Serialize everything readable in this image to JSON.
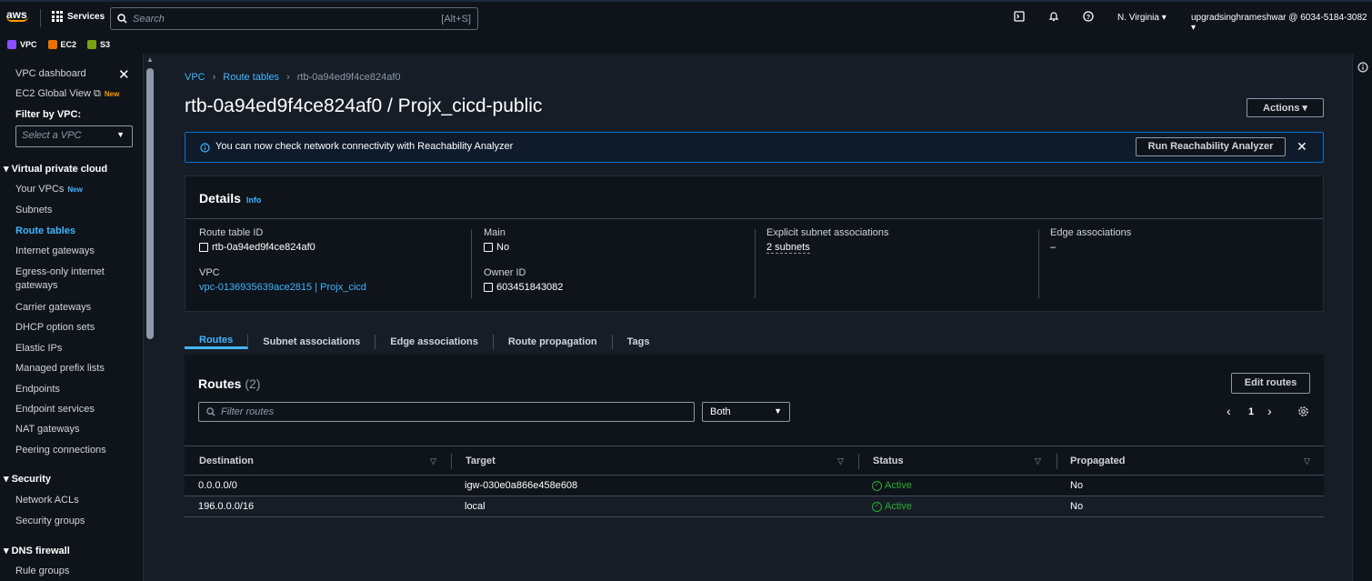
{
  "topbar": {
    "logo": "aws",
    "services": "Services",
    "search_placeholder": "Search",
    "shortcut": "[Alt+S]",
    "region": "N. Virginia ▾",
    "account": "upgradsinghrameshwar @ 6034-5184-3082 ▾"
  },
  "favorites": [
    {
      "label": "VPC",
      "color": "#8c4fff"
    },
    {
      "label": "EC2",
      "color": "#ed7100"
    },
    {
      "label": "S3",
      "color": "#7aa116"
    }
  ],
  "sidebar": {
    "dashboard": "VPC dashboard",
    "global": "EC2 Global View",
    "new_orange": "New",
    "filter": "Filter by VPC:",
    "select": "Select a VPC",
    "sections": {
      "vpc": "Virtual private cloud",
      "security": "Security",
      "dns": "DNS firewall"
    },
    "your_vpcs": "Your VPCs",
    "new": "New",
    "items": [
      "Subnets",
      "Route tables",
      "Internet gateways",
      "Egress-only internet gateways",
      "Carrier gateways",
      "DHCP option sets",
      "Elastic IPs",
      "Managed prefix lists",
      "Endpoints",
      "Endpoint services",
      "NAT gateways",
      "Peering connections"
    ],
    "security_items": [
      "Network ACLs",
      "Security groups"
    ],
    "dns_items": [
      "Rule groups"
    ]
  },
  "breadcrumb": {
    "vpc": "VPC",
    "route_tables": "Route tables",
    "current": "rtb-0a94ed9f4ce824af0"
  },
  "page_title": "rtb-0a94ed9f4ce824af0 / Projx_cicd-public",
  "actions": "Actions ▾",
  "banner": {
    "text": "You can now check network connectivity with Reachability Analyzer",
    "button": "Run Reachability Analyzer"
  },
  "details": {
    "title": "Details",
    "info": "Info",
    "rt_label": "Route table ID",
    "rt_value": "rtb-0a94ed9f4ce824af0",
    "vpc_label": "VPC",
    "vpc_value": "vpc-0136935639ace2815 | Projx_cicd",
    "main_label": "Main",
    "main_value": "No",
    "owner_label": "Owner ID",
    "owner_value": "603451843082",
    "subnet_label": "Explicit subnet associations",
    "subnet_value": "2 subnets",
    "edge_label": "Edge associations",
    "edge_value": "–"
  },
  "tabs": [
    "Routes",
    "Subnet associations",
    "Edge associations",
    "Route propagation",
    "Tags"
  ],
  "routes": {
    "title": "Routes",
    "count": "(2)",
    "edit": "Edit routes",
    "filter_placeholder": "Filter routes",
    "dropdown": "Both",
    "page": "1",
    "columns": [
      "Destination",
      "Target",
      "Status",
      "Propagated"
    ],
    "rows": [
      {
        "destination": "0.0.0.0/0",
        "target": "igw-030e0a866e458e608",
        "status": "Active",
        "propagated": "No"
      },
      {
        "destination": "196.0.0.0/16",
        "target": "local",
        "status": "Active",
        "propagated": "No"
      }
    ]
  }
}
